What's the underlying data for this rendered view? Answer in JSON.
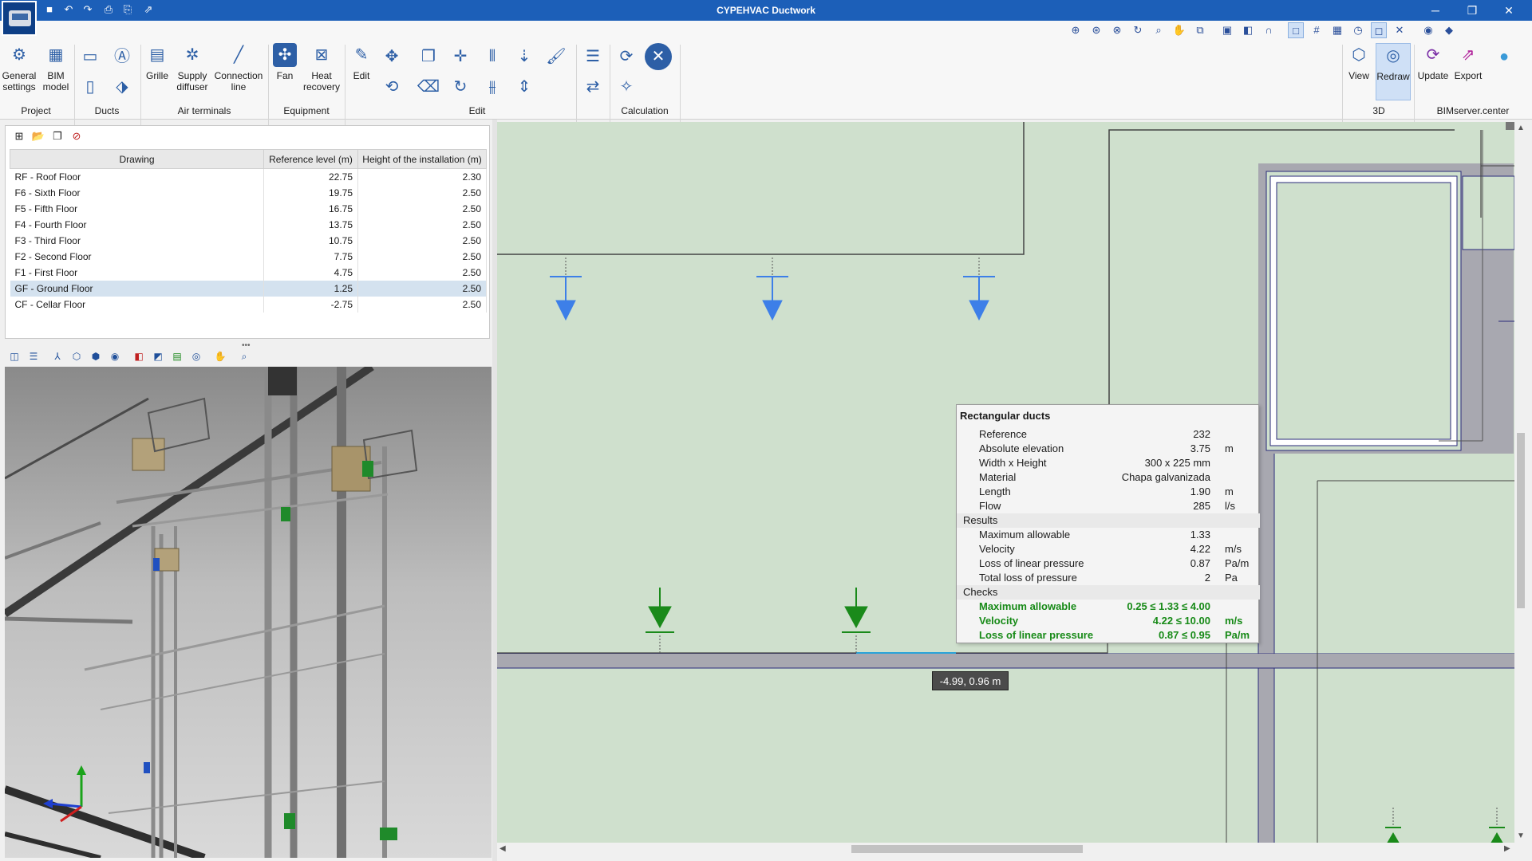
{
  "window": {
    "title": "CYPEHVAC Ductwork",
    "minimize": "─",
    "maximize": "❐",
    "close": "✕"
  },
  "quick_access": {
    "icons": [
      "save-icon",
      "undo-icon",
      "redo-icon",
      "print-icon",
      "print-preview-icon",
      "export-icon"
    ]
  },
  "ribbon": {
    "groups": {
      "project": "Project",
      "ducts": "Ducts",
      "air_terminals": "Air terminals",
      "equipment": "Equipment",
      "edit": "Edit",
      "calculation": "Calculation",
      "view3d": "3D",
      "bimserver": "BIMserver.center"
    },
    "buttons": {
      "general_settings": "General settings",
      "general_settings_line1": "General",
      "general_settings_line2": "settings",
      "bim_model_line1": "BIM",
      "bim_model_line2": "model",
      "grille": "Grille",
      "supply_line1": "Supply",
      "supply_line2": "diffuser",
      "connection_line1": "Connection",
      "connection_line2": "line",
      "fan": "Fan",
      "heat_line1": "Heat",
      "heat_line2": "recovery",
      "edit": "Edit",
      "view": "View",
      "redraw": "Redraw",
      "update": "Update",
      "export": "Export"
    }
  },
  "floors": {
    "columns": [
      "Drawing",
      "Reference level (m)",
      "Height of the installation (m)"
    ],
    "rows": [
      {
        "name": "RF - Roof Floor",
        "level": "22.75",
        "height": "2.30"
      },
      {
        "name": "F6 - Sixth Floor",
        "level": "19.75",
        "height": "2.50"
      },
      {
        "name": "F5 - Fifth Floor",
        "level": "16.75",
        "height": "2.50"
      },
      {
        "name": "F4 - Fourth Floor",
        "level": "13.75",
        "height": "2.50"
      },
      {
        "name": "F3 - Third Floor",
        "level": "10.75",
        "height": "2.50"
      },
      {
        "name": "F2 - Second Floor",
        "level": "7.75",
        "height": "2.50"
      },
      {
        "name": "F1 - First Floor",
        "level": "4.75",
        "height": "2.50"
      },
      {
        "name": "GF - Ground Floor",
        "level": "1.25",
        "height": "2.50"
      },
      {
        "name": "CF - Cellar Floor",
        "level": "-2.75",
        "height": "2.50"
      }
    ],
    "selected_row": "GF - Ground Floor"
  },
  "tooltip": {
    "title": "Rectangular ducts",
    "reference_label": "Reference",
    "reference_value": "232",
    "elevation_label": "Absolute elevation",
    "elevation_value": "3.75",
    "elevation_unit": "m",
    "size_label": "Width x Height",
    "size_value": "300 x 225 mm",
    "material_label": "Material",
    "material_value": "Chapa galvanizada",
    "length_label": "Length",
    "length_value": "1.90",
    "length_unit": "m",
    "flow_label": "Flow",
    "flow_value": "285",
    "flow_unit": "l/s",
    "results_label": "Results",
    "max_allow_label": "Maximum allowable",
    "max_allow_value": "1.33",
    "velocity_label": "Velocity",
    "velocity_value": "4.22",
    "velocity_unit": "m/s",
    "linloss_label": "Loss of linear pressure",
    "linloss_value": "0.87",
    "linloss_unit": "Pa/m",
    "totloss_label": "Total loss of pressure",
    "totloss_value": "2",
    "totloss_unit": "Pa",
    "checks_label": "Checks",
    "check1_label": "Maximum allowable",
    "check1_value": "0.25 ≤ 1.33 ≤ 4.00",
    "check2_label": "Velocity",
    "check2_value": "4.22 ≤ 10.00",
    "check2_unit": "m/s",
    "check3_label": "Loss of linear pressure",
    "check3_value": "0.87 ≤ 0.95",
    "check3_unit": "Pa/m"
  },
  "coordinates": "-4.99, 0.96 m",
  "colors": {
    "titlebar": "#1c5fb8",
    "canvas_bg": "#cfe0cd",
    "diffuser_blue": "#3d7fe8",
    "grille_green": "#1a8a1a",
    "check_ok": "#178a17"
  }
}
